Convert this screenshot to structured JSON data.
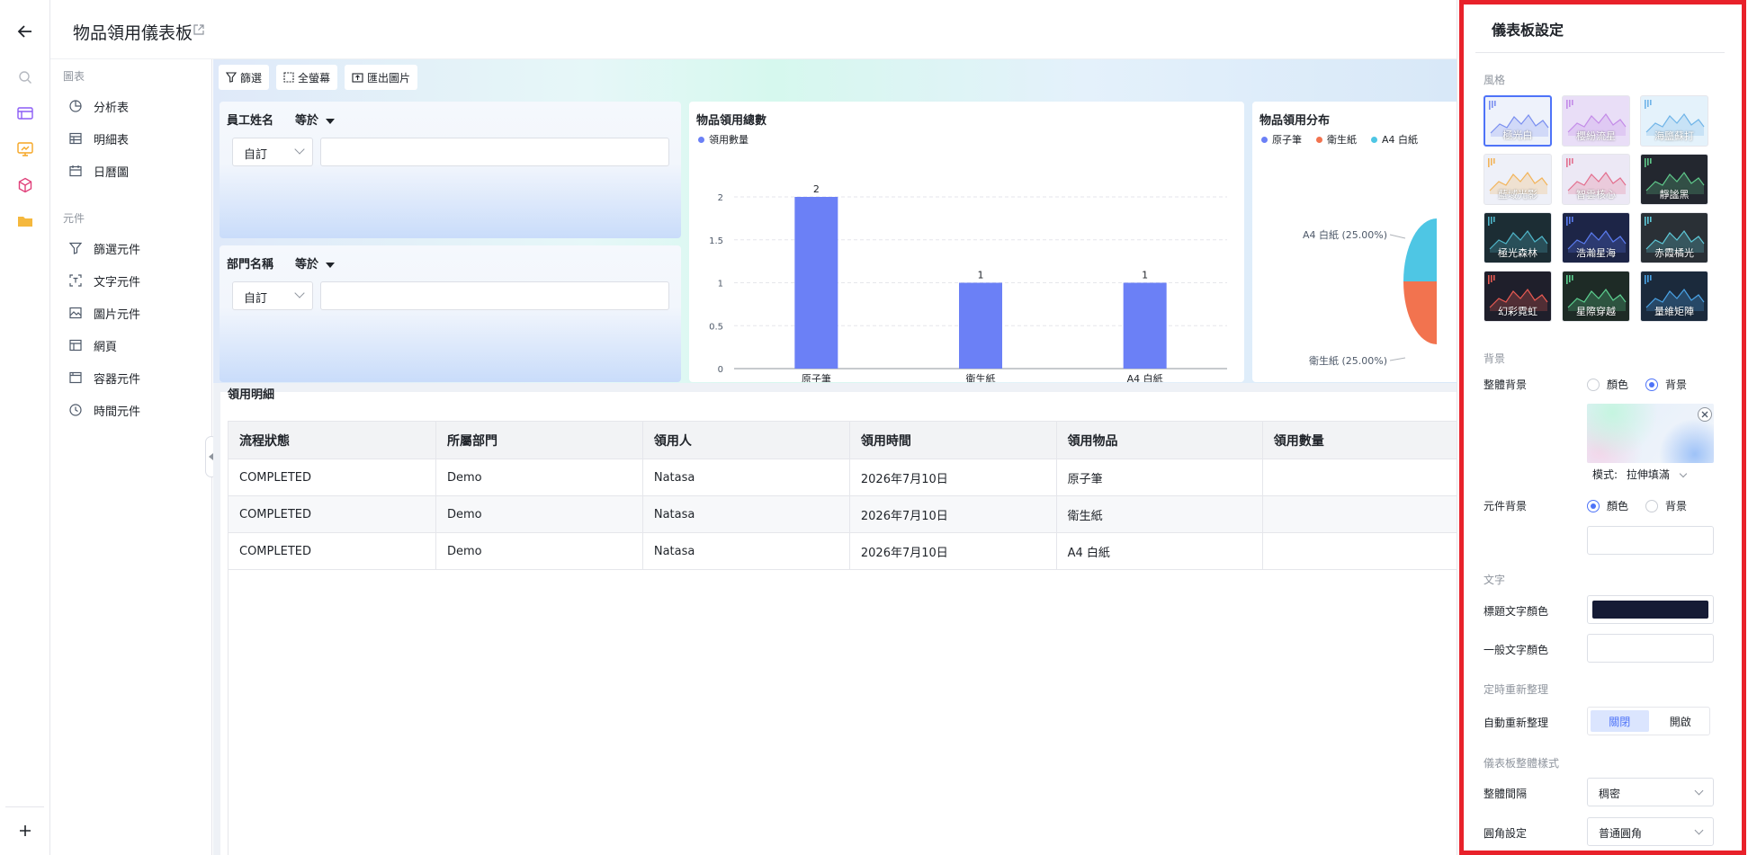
{
  "header": {
    "title": "物品領用儀表板"
  },
  "component_panel": {
    "group_charts": "圖表",
    "charts": [
      {
        "label": "分析表",
        "icon": "pie-chart-icon"
      },
      {
        "label": "明細表",
        "icon": "table-icon"
      },
      {
        "label": "日曆圖",
        "icon": "calendar-icon"
      }
    ],
    "group_widgets": "元件",
    "widgets": [
      {
        "label": "篩選元件",
        "icon": "filter-icon"
      },
      {
        "label": "文字元件",
        "icon": "text-icon"
      },
      {
        "label": "圖片元件",
        "icon": "image-icon"
      },
      {
        "label": "網頁",
        "icon": "webpage-icon"
      },
      {
        "label": "容器元件",
        "icon": "container-icon"
      },
      {
        "label": "時間元件",
        "icon": "clock-icon"
      }
    ]
  },
  "toolbar": {
    "filter": "篩選",
    "fullscreen": "全螢幕",
    "export": "匯出圖片"
  },
  "filters": [
    {
      "label": "員工姓名",
      "operator": "等於",
      "mode": "自訂",
      "value": ""
    },
    {
      "label": "部門名稱",
      "operator": "等於",
      "mode": "自訂",
      "value": ""
    }
  ],
  "chart_data": [
    {
      "type": "bar",
      "title": "物品領用總數",
      "categories": [
        "原子筆",
        "衛生紙",
        "A4 白紙"
      ],
      "series": [
        {
          "name": "領用數量",
          "values": [
            2,
            1,
            1
          ]
        }
      ],
      "yticks": [
        "0",
        "0.5",
        "1",
        "1.5",
        "2"
      ],
      "ylim": [
        0,
        2
      ],
      "grid": true,
      "legend": "top-left",
      "color": "#6b80f6"
    },
    {
      "type": "pie",
      "title": "物品領用分布",
      "legend_entries": [
        {
          "name": "原子筆",
          "color": "#6b80f6"
        },
        {
          "name": "衛生紙",
          "color": "#f2734f"
        },
        {
          "name": "A4 白紙",
          "color": "#4ec6e4"
        }
      ],
      "slice_labels": [
        {
          "name": "A4 白紙",
          "text": "A4 白紙 (25.00%)",
          "value": 25
        },
        {
          "name": "衛生紙",
          "text": "衛生紙 (25.00%)",
          "value": 25
        }
      ]
    }
  ],
  "detail_table": {
    "title": "領用明細",
    "columns": [
      "流程狀態",
      "所屬部門",
      "領用人",
      "領用時間",
      "領用物品",
      "領用數量"
    ],
    "rows": [
      [
        "COMPLETED",
        "Demo",
        "Natasa",
        "2026年7月10日",
        "原子筆",
        ""
      ],
      [
        "COMPLETED",
        "Demo",
        "Natasa",
        "2026年7月10日",
        "衛生紙",
        ""
      ],
      [
        "COMPLETED",
        "Demo",
        "Natasa",
        "2026年7月10日",
        "A4 白紙",
        ""
      ]
    ]
  },
  "settings": {
    "title": "儀表板設定",
    "style_section": "風格",
    "themes": [
      {
        "name": "極光白",
        "selected": true,
        "bg": "#eef2fb",
        "line": "#7a8ff0",
        "dark": false
      },
      {
        "name": "櫻紛流星",
        "selected": false,
        "bg": "#e9def7",
        "line": "#c48ce8",
        "dark": false
      },
      {
        "name": "海鹽蘇打",
        "selected": false,
        "bg": "#e4f2fb",
        "line": "#6fb4e8",
        "dark": false
      },
      {
        "name": "藍域光影",
        "selected": false,
        "bg": "#eef0f8",
        "line": "#f2b45a",
        "dark": false
      },
      {
        "name": "智雲核心",
        "selected": false,
        "bg": "#ece8f5",
        "line": "#e36f8e",
        "dark": false
      },
      {
        "name": "靜謐黑",
        "selected": false,
        "bg": "#23272f",
        "line": "#5fc88a",
        "dark": true
      },
      {
        "name": "極光森林",
        "selected": false,
        "bg": "#1c2d34",
        "line": "#4fb6c9",
        "dark": true
      },
      {
        "name": "浩瀚星海",
        "selected": false,
        "bg": "#1d2547",
        "line": "#5b7cf0",
        "dark": true
      },
      {
        "name": "赤霞橘光",
        "selected": false,
        "bg": "#2a3036",
        "line": "#5ec8d8",
        "dark": true
      },
      {
        "name": "幻彩霓虹",
        "selected": false,
        "bg": "#1f1f2b",
        "line": "#e95a52",
        "dark": true
      },
      {
        "name": "星際穿越",
        "selected": false,
        "bg": "#1e2b26",
        "line": "#5ccf8f",
        "dark": true
      },
      {
        "name": "量維矩陣",
        "selected": false,
        "bg": "#1b2a3c",
        "line": "#4aa3e6",
        "dark": true
      }
    ],
    "background_section": "背景",
    "overall_background_label": "整體背景",
    "overall_background_options": [
      "顏色",
      "背景"
    ],
    "overall_background_selected": "背景",
    "mode_label": "模式:",
    "mode_value": "拉伸填滿",
    "component_background_label": "元件背景",
    "component_background_options": [
      "顏色",
      "背景"
    ],
    "component_background_selected": "顏色",
    "text_section": "文字",
    "title_text_color_label": "標題文字顏色",
    "title_text_color": "#151b35",
    "body_text_color_label": "一般文字顏色",
    "body_text_color": "#ffffff",
    "refresh_section": "定時重新整理",
    "auto_refresh_label": "自動重新整理",
    "auto_refresh_options": [
      "關閉",
      "開啟"
    ],
    "auto_refresh_selected": "關閉",
    "layout_section": "儀表板整體樣式",
    "spacing_label": "整體間隔",
    "spacing_value": "稠密",
    "corner_label": "圓角設定",
    "corner_value": "普通圓角"
  }
}
